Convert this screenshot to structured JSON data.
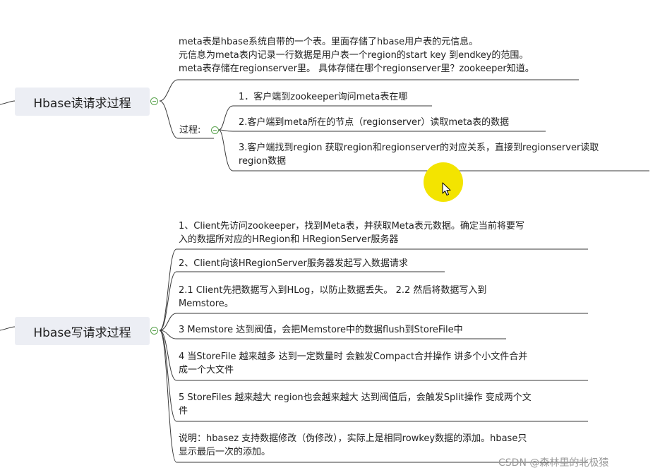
{
  "read": {
    "topic": "Hbase读请求过程",
    "meta_desc": [
      "meta表是hbase系统自带的一个表。里面存储了hbase用户表的元信息。",
      "元信息为meta表内记录一行数据是用户表一个region的start key 到endkey的范围。",
      "meta表存储在regionserver里。 具体存储在哪个regionserver里？zookeeper知道。"
    ],
    "process_label": "过程:",
    "steps": [
      [
        "1．客户端到zookeeper询问meta表在哪"
      ],
      [
        "2.客户端到meta所在的节点（regionserver）读取meta表的数据"
      ],
      [
        "3.客户端找到region 获取region和regionserver的对应关系，直接到regionserver读取",
        "region数据"
      ]
    ]
  },
  "write": {
    "topic": "Hbase写请求过程",
    "items": [
      [
        " 1、Client先访问zookeeper，找到Meta表，并获取Meta表元数据。确定当前将要写",
        "入的数据所对应的HRegion和 HRegionServer服务器"
      ],
      [
        "2、Client向该HRegionServer服务器发起写入数据请求"
      ],
      [
        "2.1 Client先把数据写入到HLog，以防止数据丢失。 2.2 然后将数据写入到",
        "Memstore。"
      ],
      [
        "3 Memstore 达到阀值，会把Memstore中的数据flush到StoreFile中"
      ],
      [
        "4 当StoreFile 越来越多 达到一定数量时 会触发Compact合并操作 讲多个小文件合并",
        "成一个大文件"
      ],
      [
        "5 StoreFiles 越来越大 region也会越来越大 达到阀值后，会触发Split操作 变成两个文",
        "件"
      ],
      [
        "说明：hbasez 支持数据修改（伪修改），实际上是相同rowkey数据的添加。hbase只",
        "显示最后一次的添加。"
      ]
    ]
  },
  "watermark": "CSDN @森林里的北极猿",
  "colors": {
    "connector": "#3a3a3a",
    "collapse": "#58a24c",
    "topic_bg": "#eceef4",
    "cursor_halo": "#f3e400"
  }
}
